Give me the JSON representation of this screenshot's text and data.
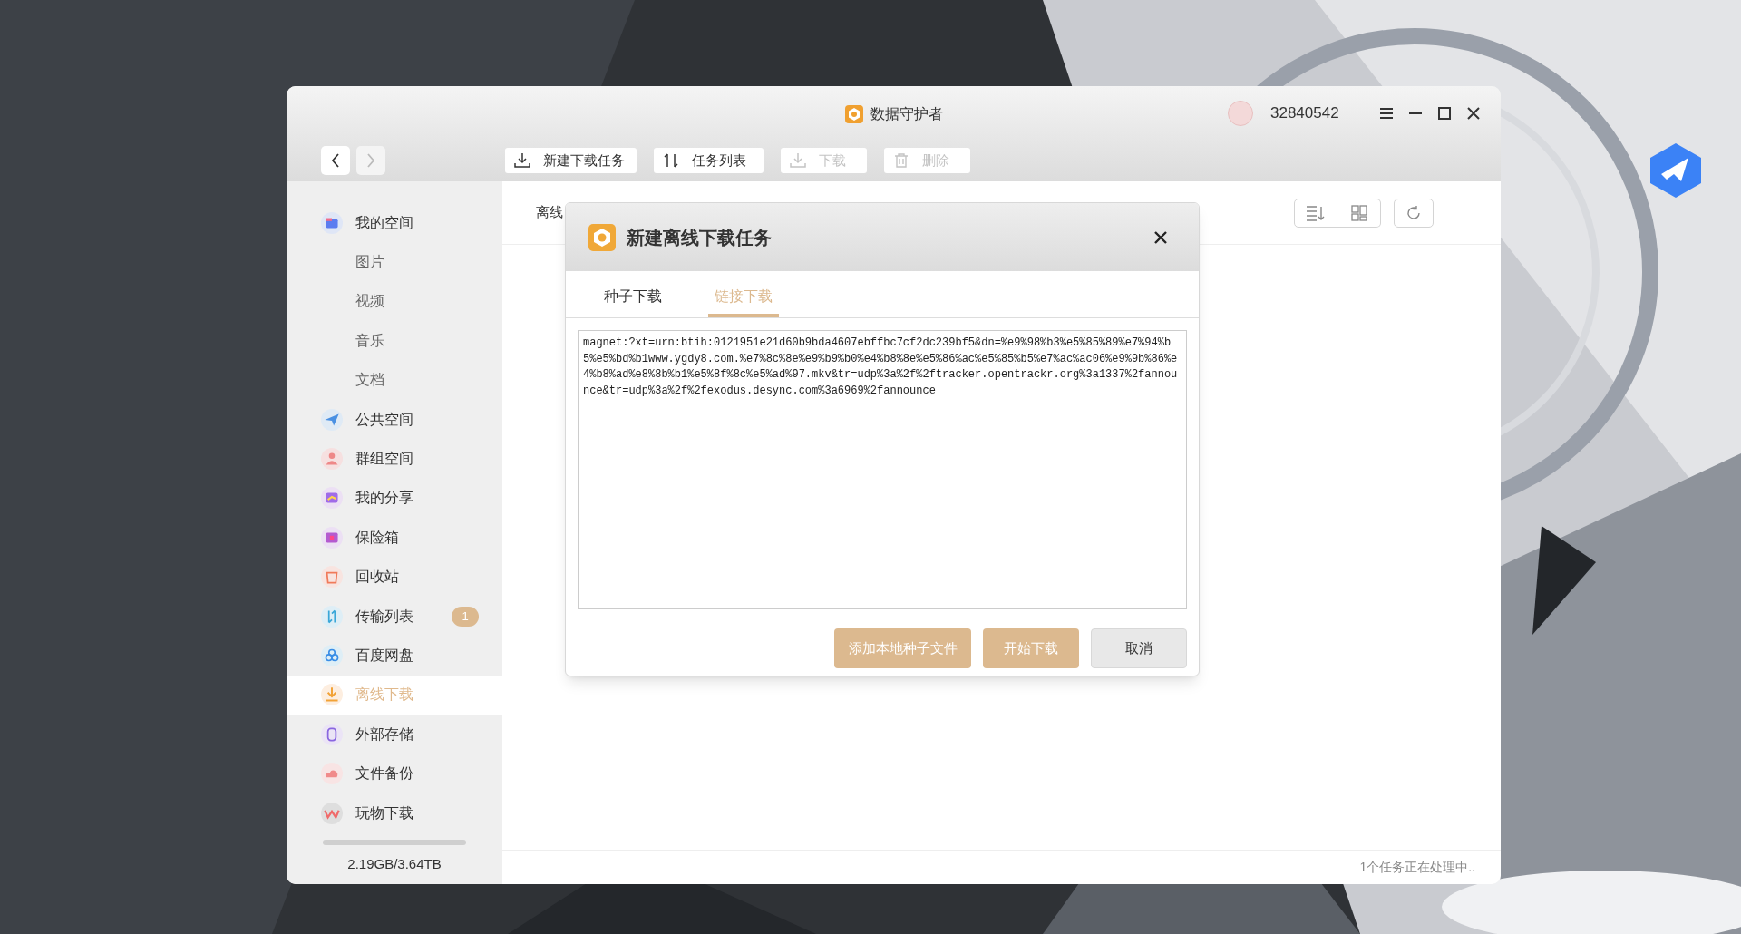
{
  "window": {
    "title": "数据守护者",
    "user": "32840542"
  },
  "nav": [
    {
      "disabled": false
    },
    {
      "disabled": true
    }
  ],
  "toolbar": [
    {
      "label": "新建下载任务",
      "disabled": false
    },
    {
      "label": "任务列表",
      "disabled": false
    },
    {
      "label": "下载",
      "disabled": true
    },
    {
      "label": "删除",
      "disabled": true
    }
  ],
  "sidebar": {
    "items": [
      {
        "label": "我的空间",
        "selected": false,
        "children": [
          {
            "label": "图片",
            "selected": false
          },
          {
            "label": "视频",
            "selected": false
          },
          {
            "label": "音乐",
            "selected": false
          },
          {
            "label": "文档",
            "selected": false
          }
        ]
      },
      {
        "label": "公共空间",
        "selected": false
      },
      {
        "label": "群组空间",
        "selected": false
      },
      {
        "label": "我的分享",
        "selected": false
      },
      {
        "label": "保险箱",
        "selected": false
      },
      {
        "label": "回收站",
        "selected": false
      },
      {
        "label": "传输列表",
        "selected": false,
        "badge": "1"
      },
      {
        "label": "百度网盘",
        "selected": false
      },
      {
        "label": "离线下载",
        "selected": true
      },
      {
        "label": "外部存储",
        "selected": false
      },
      {
        "label": "文件备份",
        "selected": false
      },
      {
        "label": "玩物下载",
        "selected": false
      }
    ],
    "storage": "2.19GB/3.64TB"
  },
  "content": {
    "heading": "离线",
    "status": "1个任务正在处理中.."
  },
  "dialog": {
    "title": "新建离线下载任务",
    "tabs": [
      {
        "label": "种子下载",
        "selected": false
      },
      {
        "label": "链接下载",
        "selected": true
      }
    ],
    "link": "magnet:?xt=urn:btih:0121951e21d60b9bda4607ebffbc7cf2dc239bf5&dn=%e9%98%b3%e5%85%89%e7%94%b5%e5%bd%b1www.ygdy8.com.%e7%8c%8e%e9%b9%b0%e4%b8%8e%e5%86%ac%e5%85%b5%e7%ac%ac06%e9%9b%86%e4%b8%ad%e8%8b%b1%e5%8f%8c%e5%ad%97.mkv&tr=udp%3a%2f%2ftracker.opentrackr.org%3a1337%2fannounce&tr=udp%3a%2f%2fexodus.desync.com%3a6969%2fannounce",
    "buttons": [
      {
        "label": "添加本地种子文件",
        "kind": "primary"
      },
      {
        "label": "开始下载",
        "kind": "primary"
      },
      {
        "label": "取消",
        "kind": "secondary"
      }
    ]
  }
}
